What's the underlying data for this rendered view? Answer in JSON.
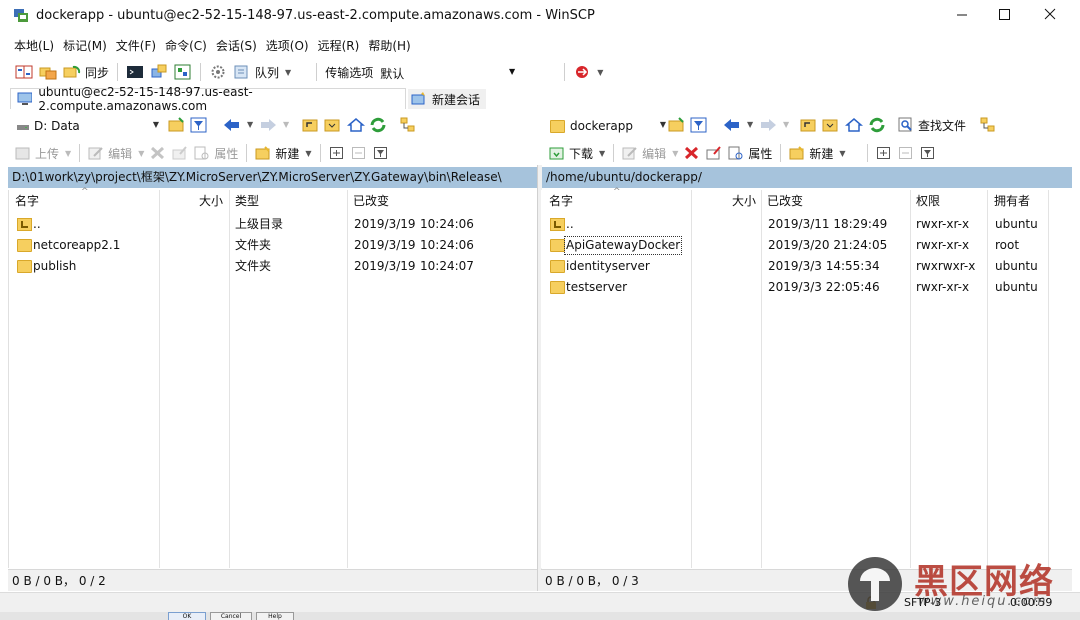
{
  "window": {
    "title": "dockerapp - ubuntu@ec2-52-15-148-97.us-east-2.compute.amazonaws.com - WinSCP"
  },
  "menu": [
    "本地(L)",
    "标记(M)",
    "文件(F)",
    "命令(C)",
    "会话(S)",
    "选项(O)",
    "远程(R)",
    "帮助(H)"
  ],
  "toolbar": {
    "sync_label": "同步",
    "queue_label": "队列",
    "transfer_options_label": "传输选项",
    "transfer_preset": "默认"
  },
  "tabs": {
    "session_label": "ubuntu@ec2-52-15-148-97.us-east-2.compute.amazonaws.com",
    "new_session_label": "新建会话"
  },
  "local": {
    "drive": "D: Data",
    "path": "D:\\01work\\zy\\project\\框架\\ZY.MicroServer\\ZY.MicroServer\\ZY.Gateway\\bin\\Release\\",
    "actions": {
      "upload": "上传",
      "edit": "编辑",
      "properties": "属性",
      "new": "新建"
    },
    "columns": {
      "name": "名字",
      "size": "大小",
      "type": "类型",
      "changed": "已改变"
    },
    "rows": [
      {
        "name": "..",
        "size": "",
        "type": "上级目录",
        "date": "2019/3/19",
        "time": "10:24:06"
      },
      {
        "name": "netcoreapp2.1",
        "size": "",
        "type": "文件夹",
        "date": "2019/3/19",
        "time": "10:24:06"
      },
      {
        "name": "publish",
        "size": "",
        "type": "文件夹",
        "date": "2019/3/19",
        "time": "10:24:07"
      }
    ],
    "status": "0 B / 0 B，  0 / 2"
  },
  "remote": {
    "folder": "dockerapp",
    "find_label": "查找文件",
    "path": "/home/ubuntu/dockerapp/",
    "actions": {
      "download": "下载",
      "edit": "编辑",
      "properties": "属性",
      "new": "新建"
    },
    "columns": {
      "name": "名字",
      "size": "大小",
      "changed": "已改变",
      "rights": "权限",
      "owner": "拥有者"
    },
    "rows": [
      {
        "name": "..",
        "size": "",
        "changed": "2019/3/11 18:29:49",
        "rights": "rwxr-xr-x",
        "owner": "ubuntu"
      },
      {
        "name": "ApiGatewayDocker",
        "size": "",
        "changed": "2019/3/20 21:24:05",
        "rights": "rwxr-xr-x",
        "owner": "root"
      },
      {
        "name": "identityserver",
        "size": "",
        "changed": "2019/3/3 14:55:34",
        "rights": "rwxrwxr-x",
        "owner": "ubuntu"
      },
      {
        "name": "testserver",
        "size": "",
        "changed": "2019/3/3 22:05:46",
        "rights": "rwxr-xr-x",
        "owner": "ubuntu"
      }
    ],
    "status": "0 B / 0 B，  0 / 3"
  },
  "statusbar": {
    "protocol": "SFTP-3",
    "elapsed": "0:00:59"
  },
  "taskbar": {
    "ok": "OK",
    "cancel": "Cancel",
    "help": "Help"
  },
  "watermark": {
    "brand": "黑区网络",
    "url": "www.heiqu.com"
  },
  "colors": {
    "path_bar": "#a6c3dc",
    "folder": "#f6cf5f",
    "delete_red": "#d8262b",
    "refresh_green": "#2e9d3a",
    "nav_blue": "#2c63c7"
  }
}
